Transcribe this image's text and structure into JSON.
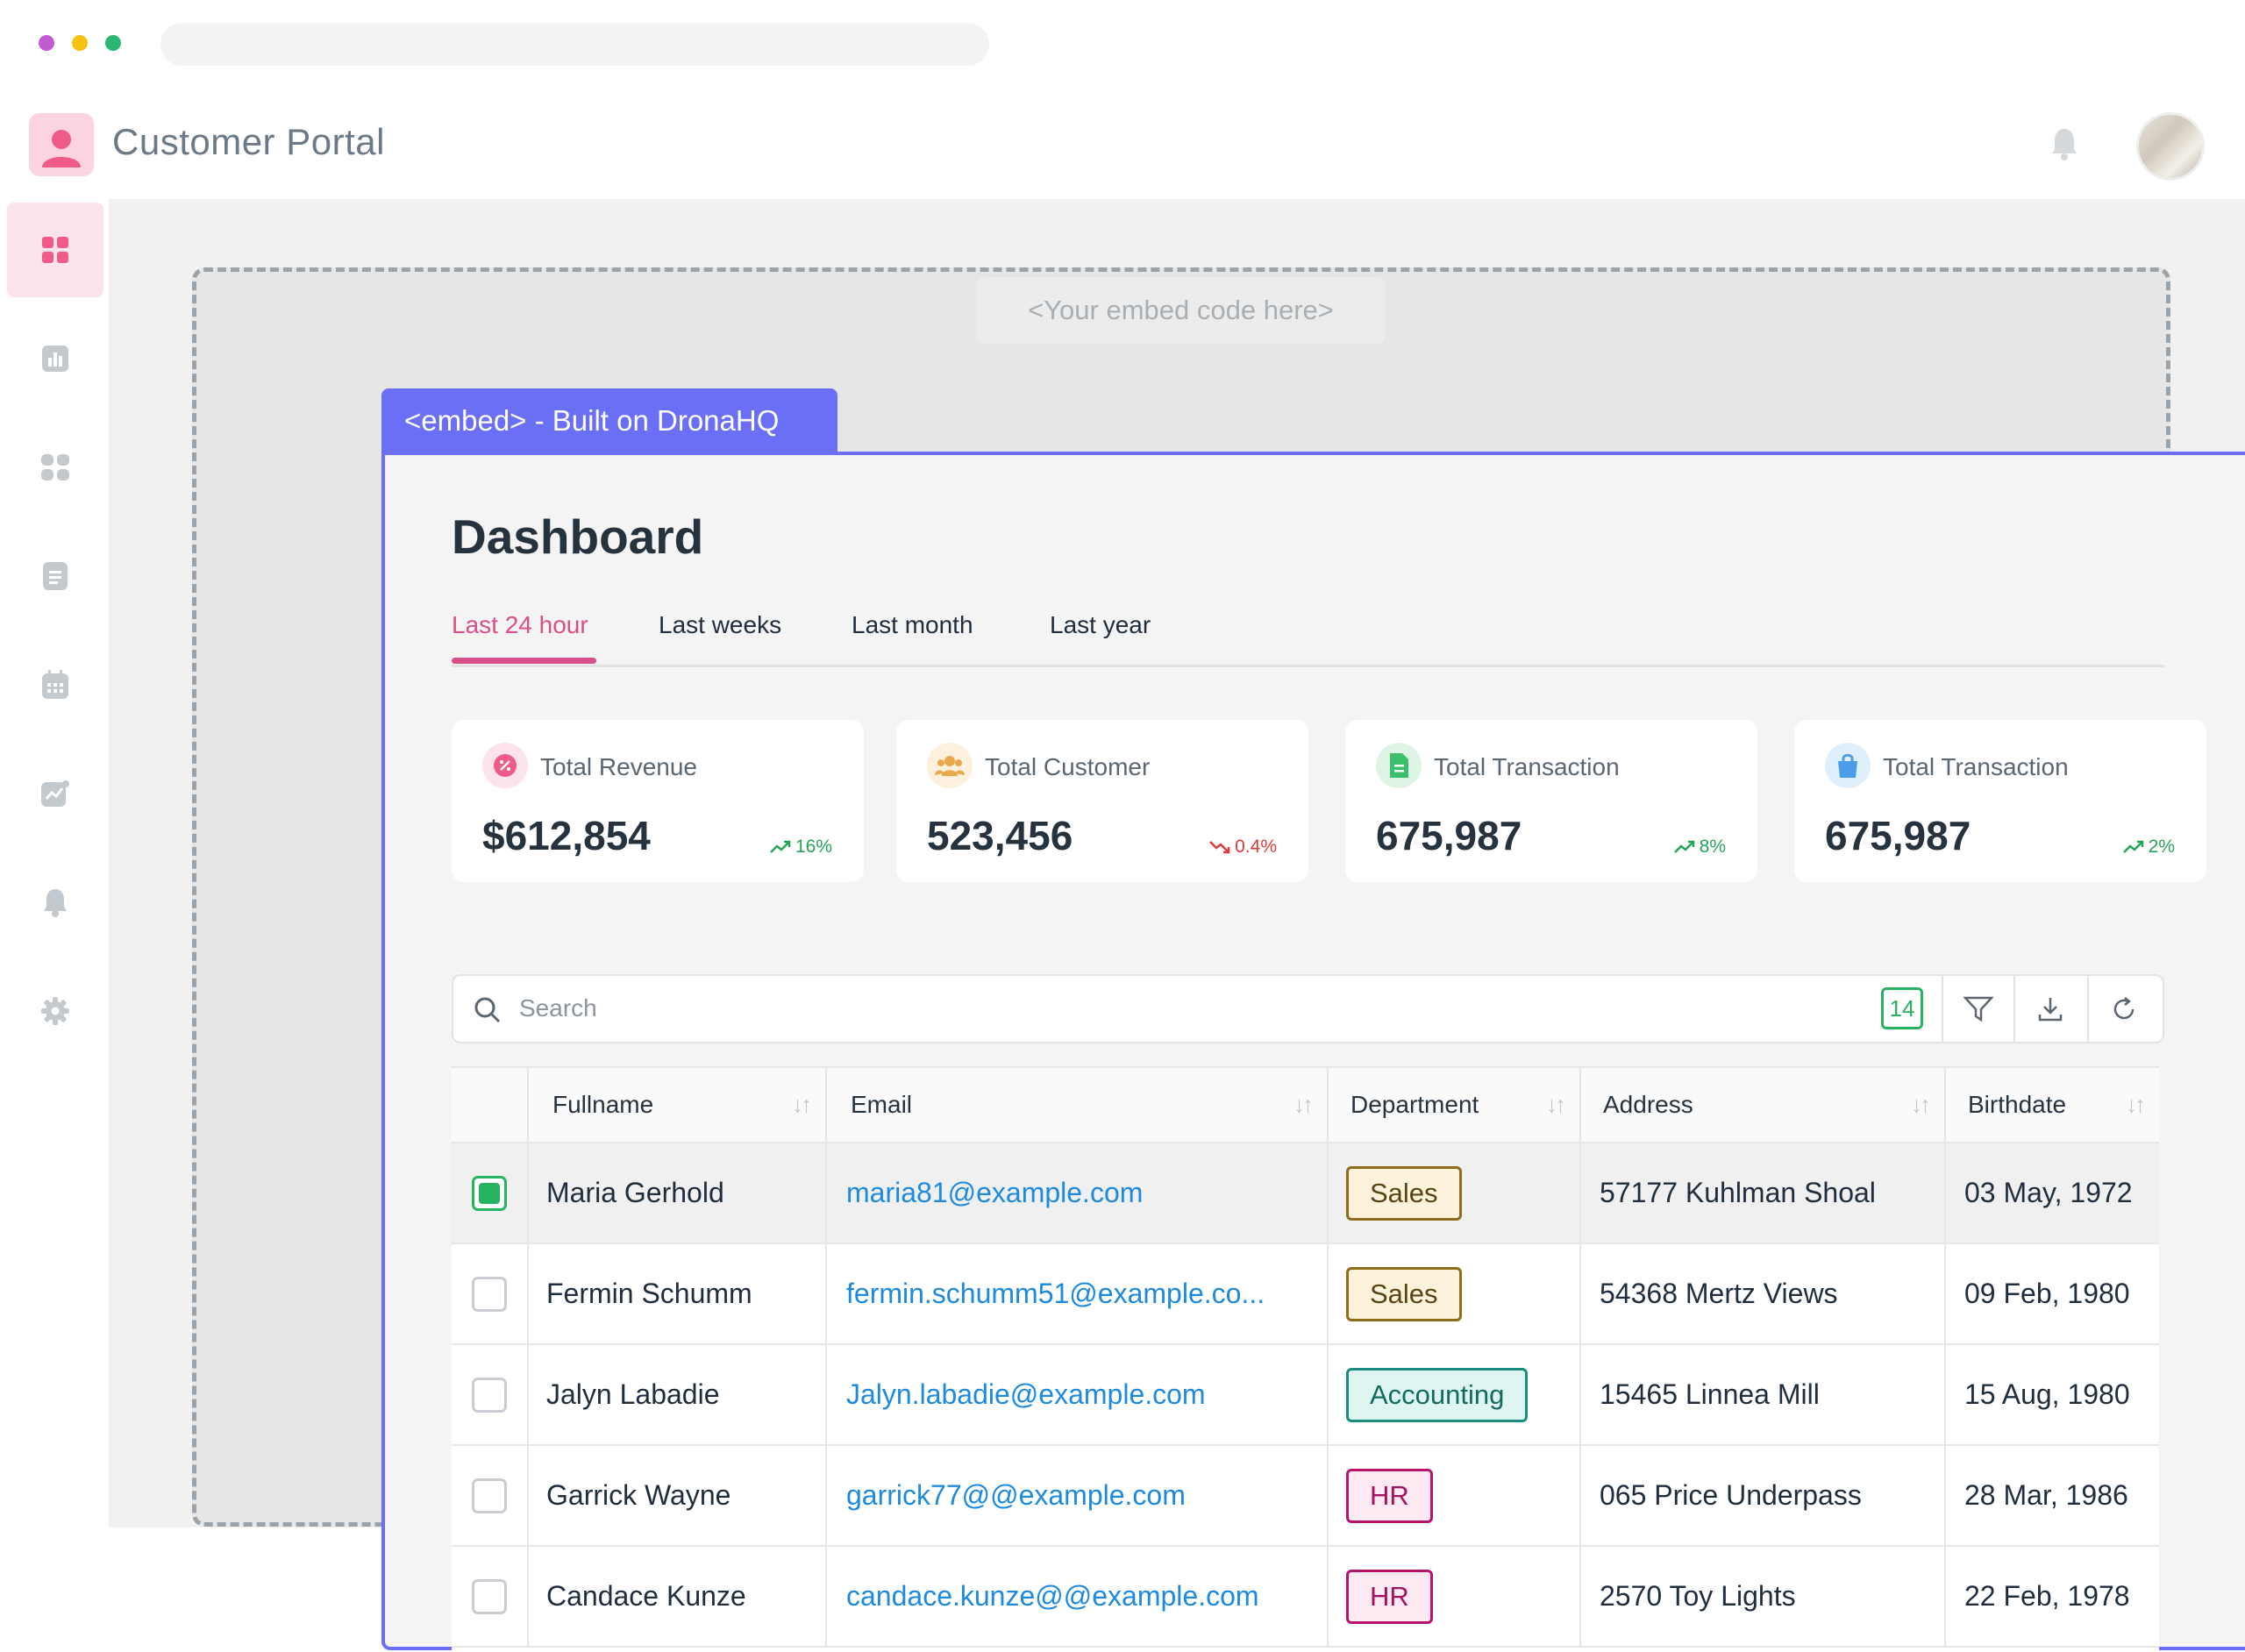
{
  "app": {
    "title": "Customer Portal"
  },
  "embed": {
    "placeholder": "<Your embed code here>",
    "tab_label": "<embed> - Built on DronaHQ"
  },
  "dashboard": {
    "title": "Dashboard",
    "tabs": [
      {
        "label": "Last 24 hour",
        "active": true
      },
      {
        "label": "Last weeks",
        "active": false
      },
      {
        "label": "Last month",
        "active": false
      },
      {
        "label": "Last year",
        "active": false
      }
    ],
    "cards": [
      {
        "label": "Total Revenue",
        "value": "$612,854",
        "change": "16%",
        "trend": "up",
        "icon": "revenue-badge-icon",
        "color": "#f05b8a"
      },
      {
        "label": "Total Customer",
        "value": "523,456",
        "change": "0.4%",
        "trend": "down",
        "icon": "customers-group-icon",
        "color": "#e9a94b"
      },
      {
        "label": "Total Transaction",
        "value": "675,987",
        "change": "8%",
        "trend": "up",
        "icon": "document-icon",
        "color": "#3bbf6a"
      },
      {
        "label": "Total Transaction",
        "value": "675,987",
        "change": "2%",
        "trend": "up",
        "icon": "shopping-bag-icon",
        "color": "#4a9de8"
      }
    ]
  },
  "search": {
    "placeholder": "Search",
    "count": "14"
  },
  "table": {
    "columns": [
      "Fullname",
      "Email",
      "Department",
      "Address",
      "Birthdate"
    ],
    "rows": [
      {
        "selected": true,
        "name": "Maria Gerhold",
        "email": "maria81@example.com",
        "department": "Sales",
        "address": "57177 Kuhlman Shoal",
        "birthdate": "03 May, 1972"
      },
      {
        "selected": false,
        "name": "Fermin Schumm",
        "email": "fermin.schumm51@example.co...",
        "department": "Sales",
        "address": "54368 Mertz Views",
        "birthdate": "09 Feb, 1980"
      },
      {
        "selected": false,
        "name": "Jalyn Labadie",
        "email": "Jalyn.labadie@example.com",
        "department": "Accounting",
        "address": "15465 Linnea Mill",
        "birthdate": "15 Aug, 1980"
      },
      {
        "selected": false,
        "name": "Garrick Wayne",
        "email": "garrick77@@example.com",
        "department": "HR",
        "address": "065 Price Underpass",
        "birthdate": "28 Mar, 1986"
      },
      {
        "selected": false,
        "name": "Candace Kunze",
        "email": "candace.kunze@@example.com",
        "department": "HR",
        "address": "2570 Toy Lights",
        "birthdate": "22 Feb, 1978"
      }
    ]
  },
  "colors": {
    "accent": "#6b6ff5",
    "active_tab": "#d8508a",
    "sidebar_active": "#fde4ec"
  }
}
